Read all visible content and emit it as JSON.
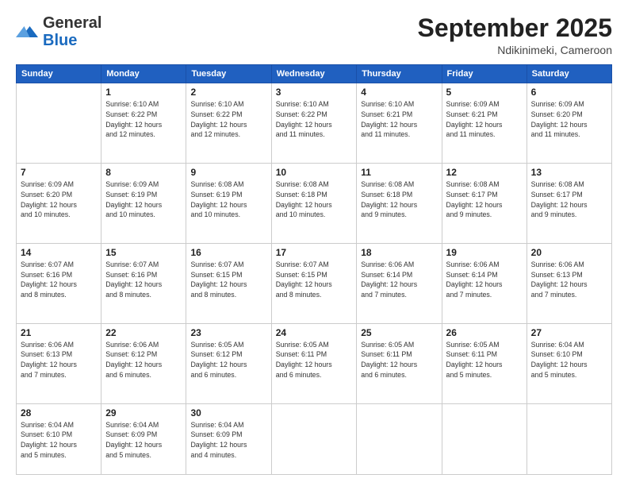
{
  "header": {
    "logo": {
      "general": "General",
      "blue": "Blue"
    },
    "title": "September 2025",
    "subtitle": "Ndikinimeki, Cameroon"
  },
  "calendar": {
    "days_of_week": [
      "Sunday",
      "Monday",
      "Tuesday",
      "Wednesday",
      "Thursday",
      "Friday",
      "Saturday"
    ],
    "weeks": [
      [
        {
          "day": "",
          "info": ""
        },
        {
          "day": "1",
          "info": "Sunrise: 6:10 AM\nSunset: 6:22 PM\nDaylight: 12 hours\nand 12 minutes."
        },
        {
          "day": "2",
          "info": "Sunrise: 6:10 AM\nSunset: 6:22 PM\nDaylight: 12 hours\nand 12 minutes."
        },
        {
          "day": "3",
          "info": "Sunrise: 6:10 AM\nSunset: 6:22 PM\nDaylight: 12 hours\nand 11 minutes."
        },
        {
          "day": "4",
          "info": "Sunrise: 6:10 AM\nSunset: 6:21 PM\nDaylight: 12 hours\nand 11 minutes."
        },
        {
          "day": "5",
          "info": "Sunrise: 6:09 AM\nSunset: 6:21 PM\nDaylight: 12 hours\nand 11 minutes."
        },
        {
          "day": "6",
          "info": "Sunrise: 6:09 AM\nSunset: 6:20 PM\nDaylight: 12 hours\nand 11 minutes."
        }
      ],
      [
        {
          "day": "7",
          "info": "Sunrise: 6:09 AM\nSunset: 6:20 PM\nDaylight: 12 hours\nand 10 minutes."
        },
        {
          "day": "8",
          "info": "Sunrise: 6:09 AM\nSunset: 6:19 PM\nDaylight: 12 hours\nand 10 minutes."
        },
        {
          "day": "9",
          "info": "Sunrise: 6:08 AM\nSunset: 6:19 PM\nDaylight: 12 hours\nand 10 minutes."
        },
        {
          "day": "10",
          "info": "Sunrise: 6:08 AM\nSunset: 6:18 PM\nDaylight: 12 hours\nand 10 minutes."
        },
        {
          "day": "11",
          "info": "Sunrise: 6:08 AM\nSunset: 6:18 PM\nDaylight: 12 hours\nand 9 minutes."
        },
        {
          "day": "12",
          "info": "Sunrise: 6:08 AM\nSunset: 6:17 PM\nDaylight: 12 hours\nand 9 minutes."
        },
        {
          "day": "13",
          "info": "Sunrise: 6:08 AM\nSunset: 6:17 PM\nDaylight: 12 hours\nand 9 minutes."
        }
      ],
      [
        {
          "day": "14",
          "info": "Sunrise: 6:07 AM\nSunset: 6:16 PM\nDaylight: 12 hours\nand 8 minutes."
        },
        {
          "day": "15",
          "info": "Sunrise: 6:07 AM\nSunset: 6:16 PM\nDaylight: 12 hours\nand 8 minutes."
        },
        {
          "day": "16",
          "info": "Sunrise: 6:07 AM\nSunset: 6:15 PM\nDaylight: 12 hours\nand 8 minutes."
        },
        {
          "day": "17",
          "info": "Sunrise: 6:07 AM\nSunset: 6:15 PM\nDaylight: 12 hours\nand 8 minutes."
        },
        {
          "day": "18",
          "info": "Sunrise: 6:06 AM\nSunset: 6:14 PM\nDaylight: 12 hours\nand 7 minutes."
        },
        {
          "day": "19",
          "info": "Sunrise: 6:06 AM\nSunset: 6:14 PM\nDaylight: 12 hours\nand 7 minutes."
        },
        {
          "day": "20",
          "info": "Sunrise: 6:06 AM\nSunset: 6:13 PM\nDaylight: 12 hours\nand 7 minutes."
        }
      ],
      [
        {
          "day": "21",
          "info": "Sunrise: 6:06 AM\nSunset: 6:13 PM\nDaylight: 12 hours\nand 7 minutes."
        },
        {
          "day": "22",
          "info": "Sunrise: 6:06 AM\nSunset: 6:12 PM\nDaylight: 12 hours\nand 6 minutes."
        },
        {
          "day": "23",
          "info": "Sunrise: 6:05 AM\nSunset: 6:12 PM\nDaylight: 12 hours\nand 6 minutes."
        },
        {
          "day": "24",
          "info": "Sunrise: 6:05 AM\nSunset: 6:11 PM\nDaylight: 12 hours\nand 6 minutes."
        },
        {
          "day": "25",
          "info": "Sunrise: 6:05 AM\nSunset: 6:11 PM\nDaylight: 12 hours\nand 6 minutes."
        },
        {
          "day": "26",
          "info": "Sunrise: 6:05 AM\nSunset: 6:11 PM\nDaylight: 12 hours\nand 5 minutes."
        },
        {
          "day": "27",
          "info": "Sunrise: 6:04 AM\nSunset: 6:10 PM\nDaylight: 12 hours\nand 5 minutes."
        }
      ],
      [
        {
          "day": "28",
          "info": "Sunrise: 6:04 AM\nSunset: 6:10 PM\nDaylight: 12 hours\nand 5 minutes."
        },
        {
          "day": "29",
          "info": "Sunrise: 6:04 AM\nSunset: 6:09 PM\nDaylight: 12 hours\nand 5 minutes."
        },
        {
          "day": "30",
          "info": "Sunrise: 6:04 AM\nSunset: 6:09 PM\nDaylight: 12 hours\nand 4 minutes."
        },
        {
          "day": "",
          "info": ""
        },
        {
          "day": "",
          "info": ""
        },
        {
          "day": "",
          "info": ""
        },
        {
          "day": "",
          "info": ""
        }
      ]
    ]
  }
}
